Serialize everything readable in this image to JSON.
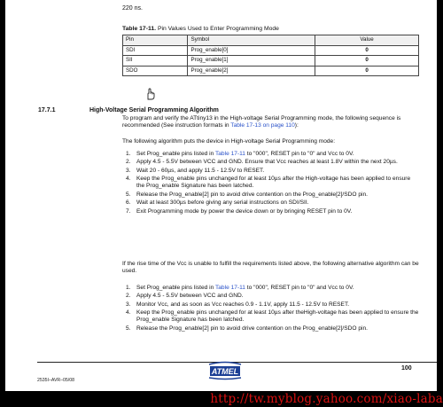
{
  "top_note": "220 ns.",
  "table": {
    "number": "Table 17-11.",
    "caption": "Pin Values Used to Enter Programming Mode",
    "headers": [
      "Pin",
      "Symbol",
      "Value"
    ],
    "rows": [
      [
        "SDI",
        "Prog_enable[0]",
        "0"
      ],
      [
        "SII",
        "Prog_enable[1]",
        "0"
      ],
      [
        "SDO",
        "Prog_enable[2]",
        "0"
      ]
    ]
  },
  "section": {
    "number": "17.7.1",
    "title": "High-Voltage Serial Programming Algorithm"
  },
  "intro": {
    "a": "To program and verify the ATtiny13 in the High-voltage Serial Programming mode, the following sequence is recommended (See instruction formats in ",
    "link": "Table 17-13 on page 110",
    "b": "):"
  },
  "algo_intro": "The following algorithm puts the device in High-voltage Serial Programming mode:",
  "steps1": [
    {
      "n": "1.",
      "a": "Set Prog_enable pins listed in ",
      "link": "Table 17-11",
      "b": " to \"000\", RESET pin to \"0\" and Vcc to 0V."
    },
    {
      "n": "2.",
      "a": "Apply 4.5 - 5.5V between VCC and GND. Ensure that Vcc reaches at least 1.8V within the next 20µs.",
      "link": "",
      "b": ""
    },
    {
      "n": "3.",
      "a": "Wait 20 - 60µs, and apply 11.5 - 12.5V to RESET.",
      "link": "",
      "b": ""
    },
    {
      "n": "4.",
      "a": "Keep the Prog_enable pins unchanged for at least 10µs after the High-voltage has been applied to ensure the Prog_enable Signature has been latched.",
      "link": "",
      "b": ""
    },
    {
      "n": "5.",
      "a": "Release the Prog_enable[2] pin to avoid drive contention on the Prog_enable[2]/SDO pin.",
      "link": "",
      "b": ""
    },
    {
      "n": "6.",
      "a": "Wait at least 300µs before giving any serial instructions on SDI/SII.",
      "link": "",
      "b": ""
    },
    {
      "n": "7.",
      "a": "Exit Programming mode by power the device down or by bringing RESET pin to 0V.",
      "link": "",
      "b": ""
    }
  ],
  "alt_intro": "If the rise time of the Vcc is unable to fulfill the requirements listed above, the following alternative algorithm can be used.",
  "steps2": [
    {
      "n": "1.",
      "a": "Set Prog_enable pins listed in ",
      "link": "Table 17-11",
      "b": " to \"000\", RESET pin to \"0\" and Vcc to 0V."
    },
    {
      "n": "2.",
      "a": "Apply 4.5 - 5.5V between VCC and GND.",
      "link": "",
      "b": ""
    },
    {
      "n": "3.",
      "a": "Monitor Vcc, and as soon as Vcc reaches 0.9 - 1.1V, apply 11.5 - 12.5V to RESET.",
      "link": "",
      "b": ""
    },
    {
      "n": "4.",
      "a": "Keep the Prog_enable pins unchanged for at least 10µs after theHigh-voltage has been applied to ensure the Prog_enable Signature has been latched.",
      "link": "",
      "b": ""
    },
    {
      "n": "5.",
      "a": "Release the Prog_enable[2] pin to avoid drive contention on the Prog_enable[2]/SDO pin.",
      "link": "",
      "b": ""
    }
  ],
  "footer": {
    "doc_code": "2535I–AVR–05/08",
    "page_number": "100",
    "logo_text": "ATMEL"
  },
  "watermark": "http://tw.myblog.yahoo.com/xiao-laba",
  "colors": {
    "link": "#2a52c9",
    "watermark": "#dd1111"
  }
}
